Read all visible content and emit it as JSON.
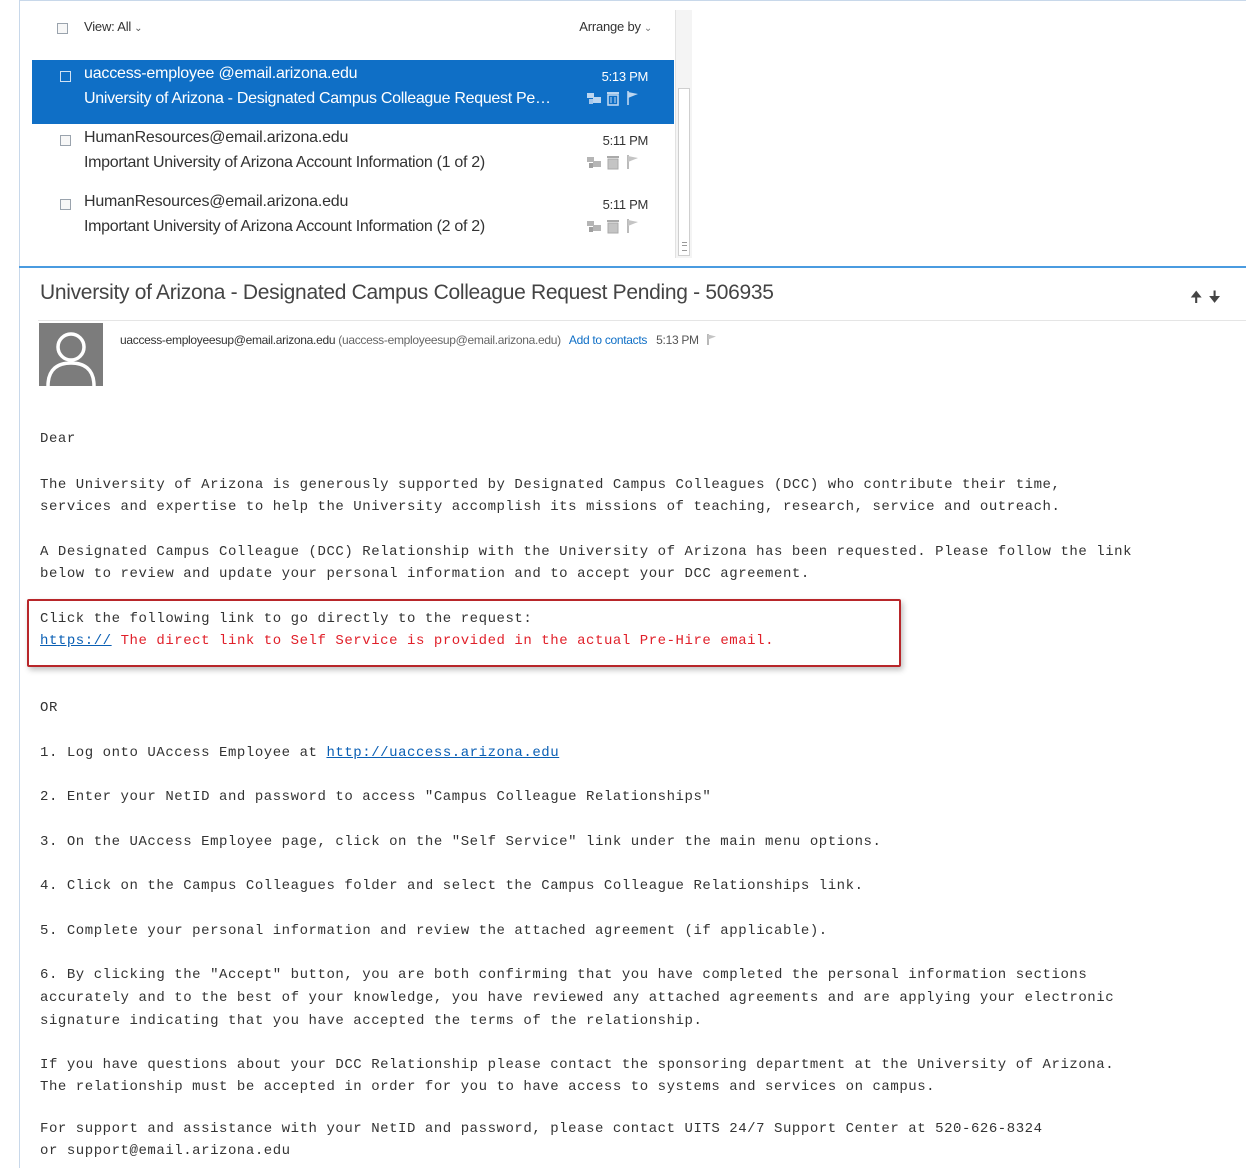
{
  "list": {
    "header": {
      "view_label": "View: All",
      "arrange_label": "Arrange by"
    },
    "messages": [
      {
        "from": "uaccess-employee     @email.arizona.edu",
        "subject": "University of Arizona - Designated Campus Colleague Request Pending - 506935",
        "time": "5:13 PM",
        "selected": true
      },
      {
        "from": "HumanResources@email.arizona.edu",
        "subject": "Important University of Arizona Account Information (1 of 2)",
        "time": "5:11 PM",
        "selected": false
      },
      {
        "from": "HumanResources@email.arizona.edu",
        "subject": "Important University of Arizona Account Information (2 of 2)",
        "time": "5:11 PM",
        "selected": false
      }
    ]
  },
  "reading": {
    "title": "University of Arizona - Designated Campus Colleague Request Pending - 506935",
    "sender_address": "uaccess-employeesup@email.arizona.edu",
    "sender_paren": "(uaccess-employeesup@email.arizona.edu)",
    "add_to_contacts": "Add to contacts",
    "time": "5:13 PM"
  },
  "body": {
    "greeting": "Dear",
    "p1_l1": "The University of Arizona is generously supported by Designated Campus Colleagues (DCC) who contribute their time,",
    "p1_l2": "services and expertise to help the University accomplish its missions of teaching, research, service and outreach.",
    "p2_l1": "A Designated Campus Colleague (DCC) Relationship with the University of Arizona has been requested. Please follow the link",
    "p2_l2": "below to review and update your personal information and to accept your DCC agreement.",
    "click_line": "Click the following link to go directly to the request:",
    "link_prefix": "https://",
    "link_note": " The direct link to Self Service is provided in the actual Pre-Hire email.",
    "or": "OR",
    "step1_prefix": "1. Log onto UAccess Employee at ",
    "step1_link": "http://uaccess.arizona.edu",
    "step2": "2. Enter your NetID and password to access \"Campus Colleague Relationships\"",
    "step3": "3. On the UAccess Employee page, click on the \"Self Service\" link under the main menu options.",
    "step4": "4. Click on the Campus Colleagues folder and select the Campus Colleague Relationships link.",
    "step5": "5. Complete your personal information and review the attached agreement (if applicable).",
    "step6_l1": "6. By clicking the \"Accept\" button, you are both confirming that you have completed the personal information sections",
    "step6_l2": "accurately and to the best of your knowledge, you have reviewed any attached agreements and are applying your electronic",
    "step6_l3": "signature indicating that you have accepted the terms of the relationship.",
    "q_l1": "If you have questions about your DCC Relationship please contact the sponsoring department at the University of Arizona.",
    "q_l2": "The relationship must be accepted in order for you to have access to systems and services on campus.",
    "sup_l1": "For support and assistance with your NetID and password, please contact UITS 24/7 Support Center at 520-626-8324",
    "sup_l2": "or support@email.arizona.edu"
  },
  "colors": {
    "accent": "#0f6fc6",
    "highlight_border": "#b8262a",
    "note_red": "#e0202a",
    "link": "#0a5fb4"
  },
  "icons": [
    "chevron-down-icon",
    "categorize-icon",
    "delete-icon",
    "flag-icon",
    "avatar-icon",
    "up-arrow-icon",
    "down-arrow-icon"
  ]
}
